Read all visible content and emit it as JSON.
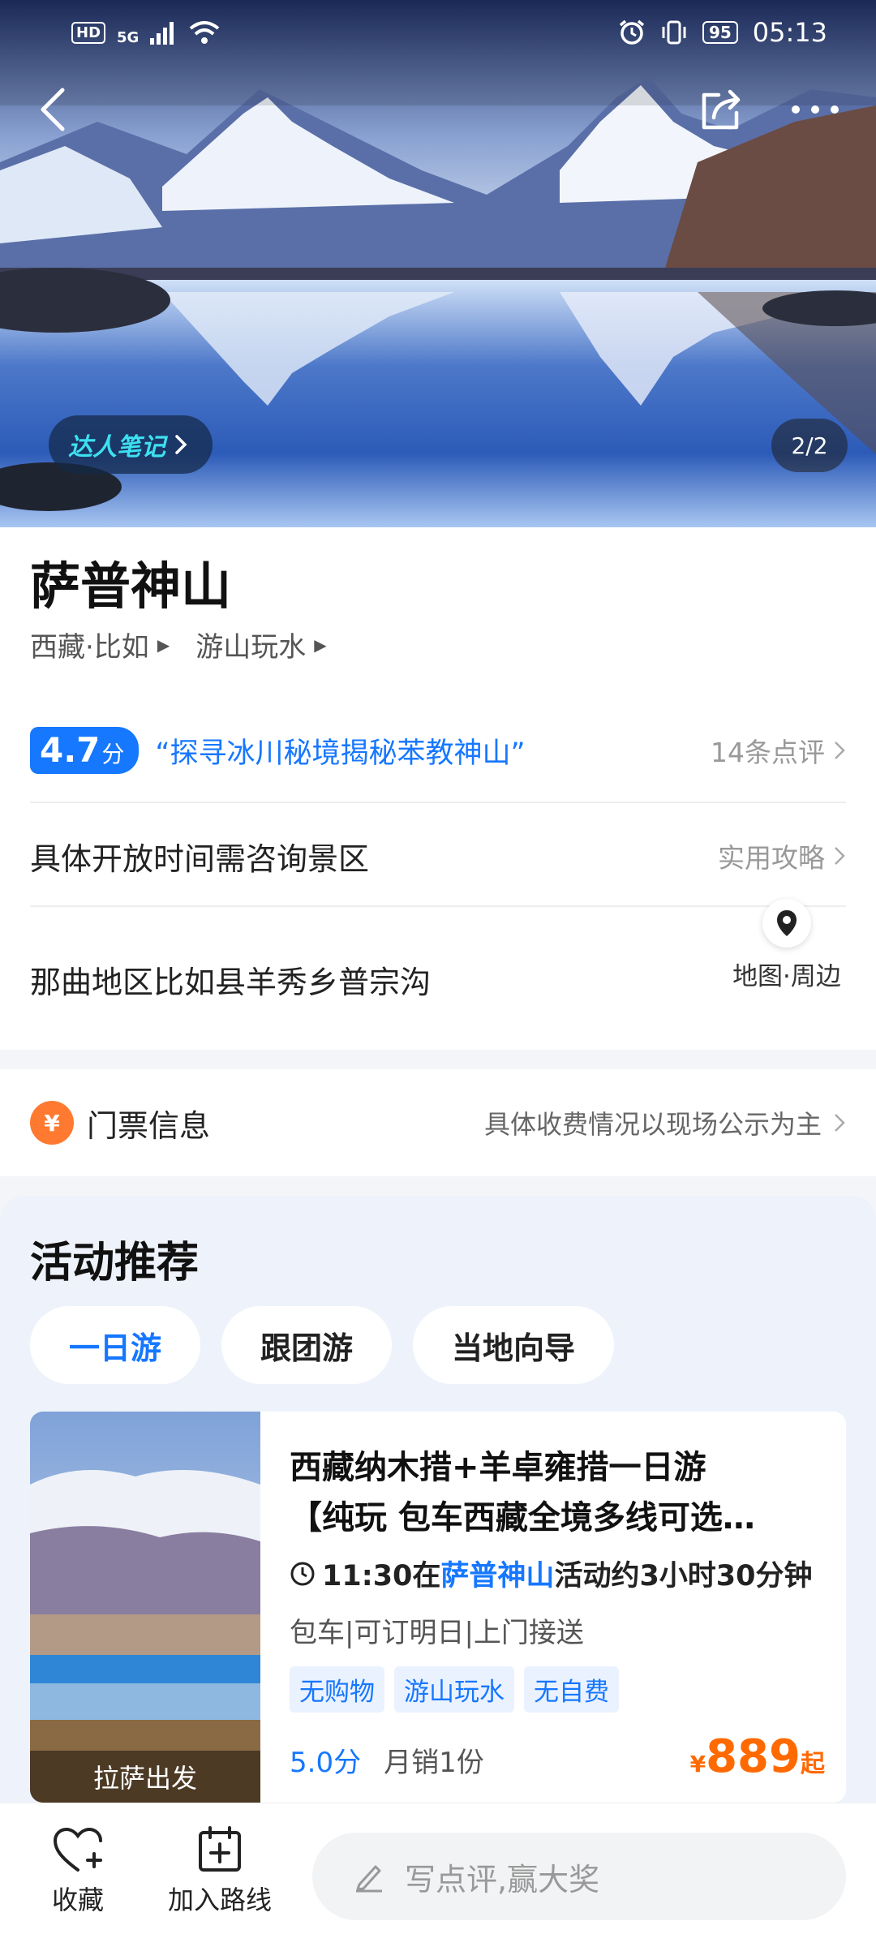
{
  "status_bar": {
    "left_label": "HD",
    "network": "5G",
    "battery": "95",
    "time": "05:13"
  },
  "hero": {
    "expert_notes": "达人笔记",
    "page_counter": "2/2"
  },
  "attraction": {
    "name": "萨普神山",
    "breadcrumb_location": "西藏·比如",
    "breadcrumb_category": "游山玩水"
  },
  "rating": {
    "score": "4.7",
    "unit": "分",
    "quote": "“探寻冰川秘境揭秘苯教神山”",
    "reviews": "14条点评"
  },
  "hours": {
    "text": "具体开放时间需咨询景区",
    "guide_link": "实用攻略"
  },
  "address": {
    "text": "那曲地区比如县羊秀乡普宗沟",
    "map_label": "地图·周边"
  },
  "ticket": {
    "icon_glyph": "¥",
    "label": "门票信息",
    "note": "具体收费情况以现场公示为主"
  },
  "activities": {
    "title": "活动推荐",
    "tabs": [
      "一日游",
      "跟团游",
      "当地向导"
    ],
    "card": {
      "thumb_label": "拉萨出发",
      "title_line1": "西藏纳木措+羊卓雍措一日游",
      "title_line2": "【纯玩 包车西藏全境多线可选…",
      "time_prefix": "11:30在",
      "time_place": "萨普神山",
      "time_suffix": "活动约3小时30分钟",
      "meta": "包车|可订明日|上门接送",
      "tags": [
        "无购物",
        "游山玩水",
        "无自费"
      ],
      "rating": "5.0分",
      "sales": "月销1份",
      "price_currency": "¥",
      "price": "889",
      "price_suffix": "起"
    }
  },
  "bottom_bar": {
    "favorite": "收藏",
    "add_route": "加入路线",
    "comment_placeholder": "写点评,赢大奖"
  },
  "colors": {
    "accent": "#1677ff",
    "price": "#ff6a00",
    "ticket_icon": "#ff7a30"
  }
}
